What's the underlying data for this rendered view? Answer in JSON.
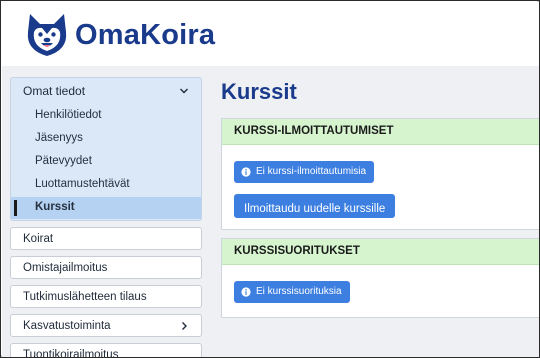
{
  "brand": {
    "name": "OmaKoira"
  },
  "sidebar": {
    "group": {
      "label": "Omat tiedot",
      "items": [
        {
          "label": "Henkilötiedot"
        },
        {
          "label": "Jäsenyys"
        },
        {
          "label": "Pätevyydet"
        },
        {
          "label": "Luottamustehtävät"
        },
        {
          "label": "Kurssit",
          "active": true
        }
      ]
    },
    "items": [
      {
        "label": "Koirat"
      },
      {
        "label": "Omistajailmoitus"
      },
      {
        "label": "Tutkimuslähetteen tilaus"
      },
      {
        "label": "Kasvatustoiminta",
        "has_chevron": true
      },
      {
        "label": "Tuontikoirailmoitus"
      }
    ]
  },
  "main": {
    "title": "Kurssit",
    "registrations": {
      "header": "KURSSI-ILMOITTAUTUMISET",
      "empty_badge": "Ei kurssi-ilmoittautumisia",
      "register_button": "Ilmoittaudu uudelle kurssille"
    },
    "completions": {
      "header": "KURSSISUORITUKSET",
      "empty_badge": "Ei kurssisuorituksia"
    }
  },
  "colors": {
    "brand": "#1a3a8c",
    "accent": "#3d7fe0",
    "card_header": "#d6f5cf",
    "sidebar_group": "#dbe8f8",
    "sidebar_active": "#b5d2f3"
  },
  "icons": {
    "logo": "dog-face-logo",
    "group_toggle": "chevron-down-icon",
    "submenu": "chevron-right-icon",
    "badge": "info-icon"
  }
}
